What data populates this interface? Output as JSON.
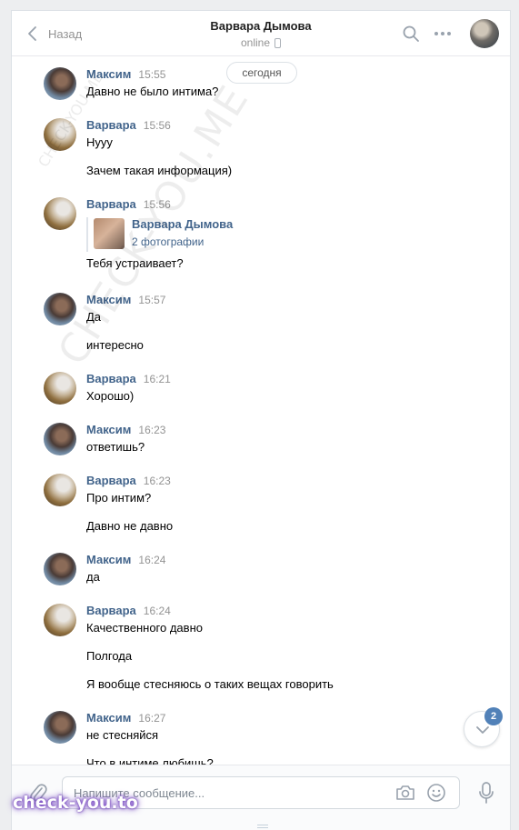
{
  "header": {
    "back_label": "Назад",
    "title": "Варвара Дымова",
    "status": "online"
  },
  "date_divider": "сегодня",
  "messages": [
    {
      "author": "Максим",
      "time": "15:55",
      "lines": [
        "Давно не было интима?"
      ]
    },
    {
      "author": "Варвара",
      "time": "15:56",
      "lines": [
        "Нууу",
        "Зачем такая информация)"
      ]
    },
    {
      "author": "Варвара",
      "time": "15:56",
      "attachment": {
        "name": "Варвара Дымова",
        "count": "2 фотографии"
      },
      "lines": [
        "Тебя устраивает?"
      ]
    },
    {
      "author": "Максим",
      "time": "15:57",
      "lines": [
        "Да",
        "интересно"
      ]
    },
    {
      "author": "Варвара",
      "time": "16:21",
      "lines": [
        "Хорошо)"
      ]
    },
    {
      "author": "Максим",
      "time": "16:23",
      "lines": [
        "ответишь?"
      ]
    },
    {
      "author": "Варвара",
      "time": "16:23",
      "lines": [
        "Про интим?",
        "Давно не давно"
      ]
    },
    {
      "author": "Максим",
      "time": "16:24",
      "lines": [
        "да"
      ]
    },
    {
      "author": "Варвара",
      "time": "16:24",
      "lines": [
        "Качественного давно",
        "Полгода",
        "Я вообще стесняюсь о таких вещах говорить"
      ]
    },
    {
      "author": "Максим",
      "time": "16:27",
      "lines": [
        "не стесняйся",
        "Что в интиме любишь?"
      ]
    }
  ],
  "unread_badge": "2",
  "composer": {
    "placeholder": "Напишите сообщение..."
  },
  "watermarks": {
    "diagonal": "CHECK-YOU.ME",
    "small": "CHECK-YOU.ME",
    "logo": "check-you.to"
  },
  "colors": {
    "link": "#42648b",
    "accent": "#5181b8",
    "meta": "#939393"
  }
}
